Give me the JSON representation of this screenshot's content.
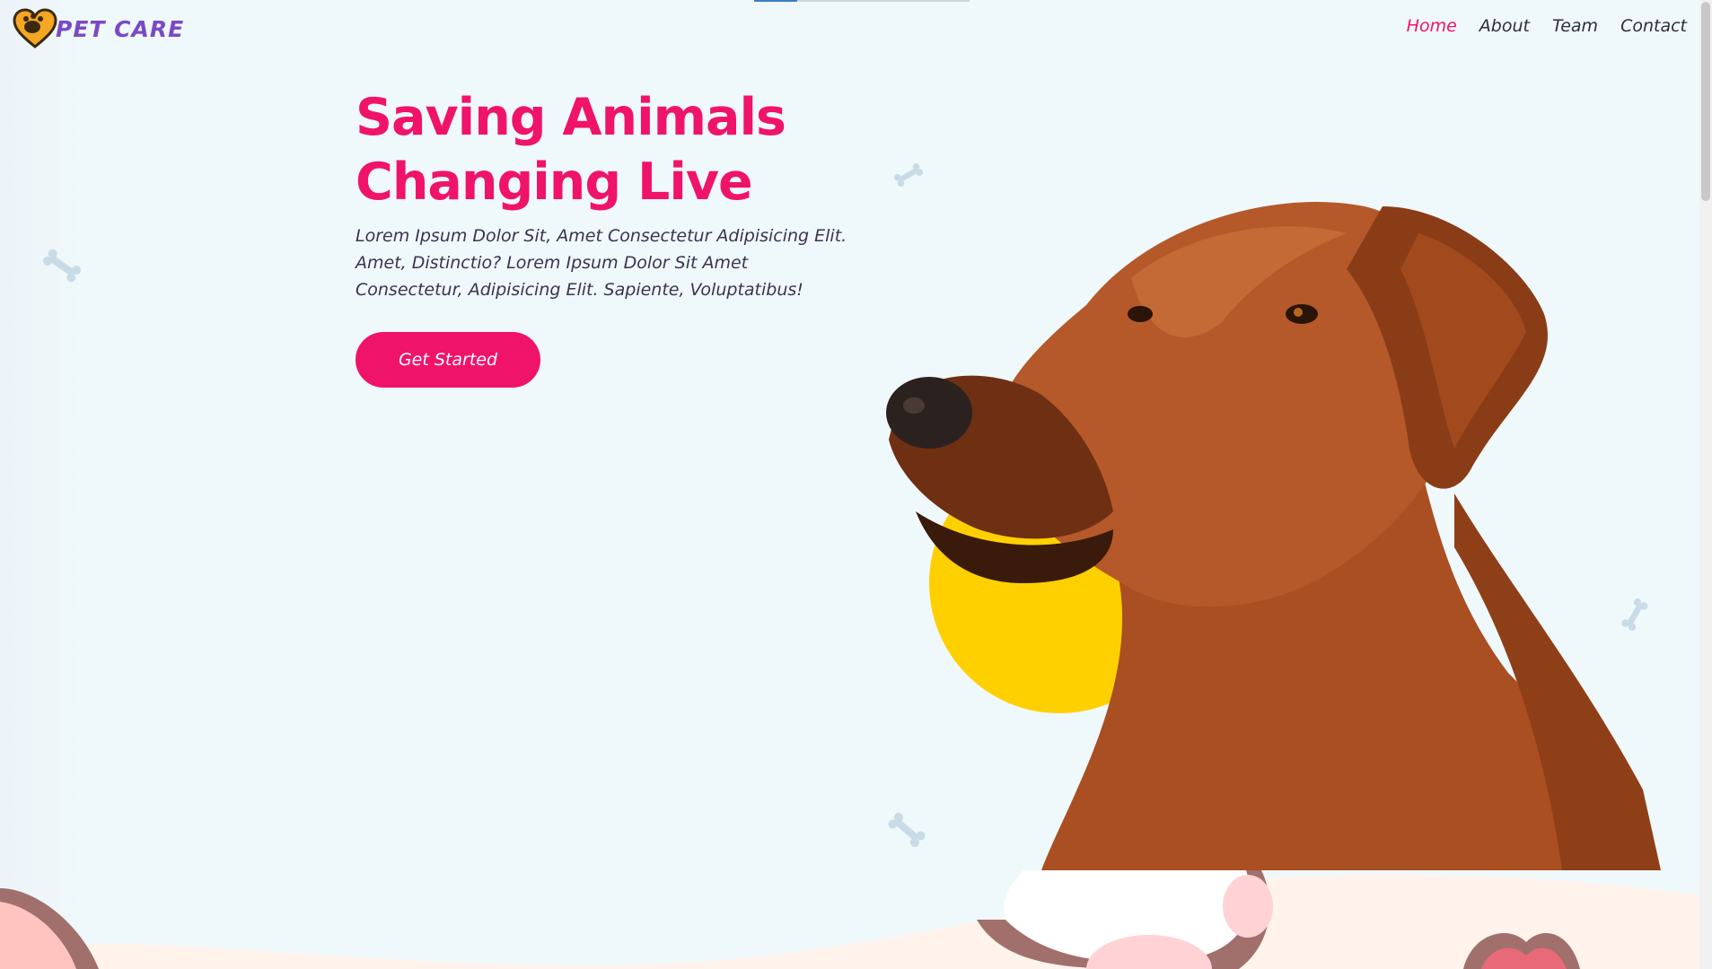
{
  "brand": {
    "name": "PET CARE",
    "logo_icon": "heart-paw-logo-icon"
  },
  "nav": {
    "items": [
      {
        "label": "Home",
        "active": true
      },
      {
        "label": "About",
        "active": false
      },
      {
        "label": "Team",
        "active": false
      },
      {
        "label": "Contact",
        "active": false
      }
    ]
  },
  "hero": {
    "title_line1": "Saving Animals",
    "title_line2": "Changing Live",
    "description": "Lorem Ipsum Dolor Sit, Amet Consectetur Adipisicing Elit. Amet, Distinctio? Lorem Ipsum Dolor Sit Amet Consectetur, Adipisicing Elit. Sapiente, Voluptatibus!",
    "cta_label": "Get Started"
  },
  "colors": {
    "accent": "#f0136a",
    "brand": "#7a4ac6",
    "background": "#eff8fb",
    "sun": "#ffd000",
    "dog": "#b5592a",
    "bone": "#c9dbe6",
    "wave": "#fff3ec"
  },
  "decorations": [
    "bone-icon",
    "dog-image",
    "sun-circle",
    "paw-illustration"
  ]
}
